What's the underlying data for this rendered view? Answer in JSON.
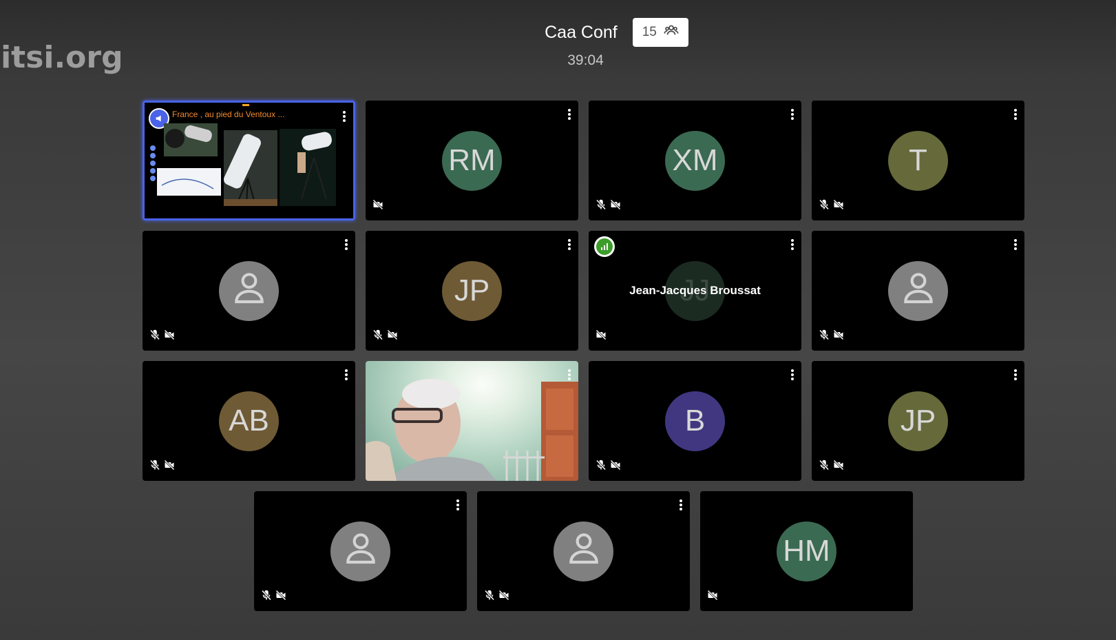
{
  "watermark": "jitsi.org",
  "header": {
    "conference_title": "Caa Conf",
    "participant_count": "15",
    "timer": "39:04"
  },
  "colors": {
    "active_border": "#4a63e8",
    "connection_good": "#3c9d2b"
  },
  "tiles": [
    {
      "type": "screenshare",
      "slide_title": "France , au pied du Ventoux ..."
    },
    {
      "initials": "RM",
      "color": "#3b6a52",
      "muted": false,
      "video_off": true
    },
    {
      "initials": "XM",
      "color": "#3b6a52",
      "muted": true,
      "video_off": true
    },
    {
      "initials": "T",
      "color": "#66693a",
      "muted": true,
      "video_off": true
    },
    {
      "initials": "",
      "avatar": "person-icon",
      "muted": true,
      "video_off": true
    },
    {
      "initials": "JP",
      "color": "#6e5a35",
      "muted": true,
      "video_off": true
    },
    {
      "initials": "JJ",
      "color": "#1c2b22",
      "display_name": "Jean-Jacques Broussat",
      "muted": false,
      "video_off": true
    },
    {
      "initials": "",
      "avatar": "person-icon",
      "muted": true,
      "video_off": true
    },
    {
      "initials": "AB",
      "color": "#6e5a35",
      "muted": true,
      "video_off": true
    },
    {
      "type": "video"
    },
    {
      "initials": "B",
      "color": "#413780",
      "muted": true,
      "video_off": true
    },
    {
      "initials": "JP",
      "color": "#66693a",
      "muted": true,
      "video_off": true
    },
    {
      "initials": "",
      "avatar": "person-icon",
      "muted": true,
      "video_off": true
    },
    {
      "initials": "",
      "avatar": "person-icon",
      "muted": true,
      "video_off": true
    },
    {
      "initials": "HM",
      "color": "#3b6a52",
      "muted": false,
      "video_off": true
    }
  ]
}
